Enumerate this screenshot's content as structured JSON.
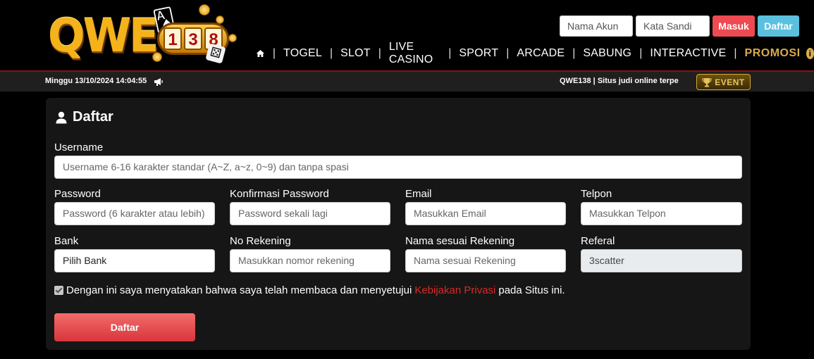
{
  "brand": {
    "logo_text": "QWE",
    "logo_digits": [
      "1",
      "3",
      "8"
    ]
  },
  "login": {
    "username_placeholder": "Nama Akun",
    "password_placeholder": "Kata Sandi",
    "login_label": "Masuk",
    "register_label": "Daftar"
  },
  "nav": {
    "home_icon": "home-icon",
    "items": [
      "TOGEL",
      "SLOT",
      "LIVE CASINO",
      "SPORT",
      "ARCADE",
      "SABUNG",
      "INTERACTIVE"
    ],
    "promo": "PROMOSI"
  },
  "ticker": {
    "datetime": "Minggu 13/10/2024 14:04:55",
    "marquee": "QWE138 | Situs judi online terpe",
    "event_label": "EVENT"
  },
  "form": {
    "title": "Daftar",
    "username": {
      "label": "Username",
      "placeholder": "Username 6-16 karakter standar (A~Z, a~z, 0~9) dan tanpa spasi"
    },
    "password": {
      "label": "Password",
      "placeholder": "Password (6 karakter atau lebih)"
    },
    "confirm": {
      "label": "Konfirmasi Password",
      "placeholder": "Password sekali lagi"
    },
    "email": {
      "label": "Email",
      "placeholder": "Masukkan Email"
    },
    "phone": {
      "label": "Telpon",
      "placeholder": "Masukkan Telpon"
    },
    "bank": {
      "label": "Bank",
      "value": "Pilih Bank"
    },
    "account_no": {
      "label": "No Rekening",
      "placeholder": "Masukkan nomor rekening"
    },
    "account_name": {
      "label": "Nama sesuai Rekening",
      "placeholder": "Nama sesuai Rekening"
    },
    "referral": {
      "label": "Referal",
      "value": "3scatter"
    },
    "agree_prefix": "Dengan ini saya menyatakan bahwa saya telah membaca dan menyetujui",
    "agree_link": "Kebijakan Privasi",
    "agree_suffix": "pada Situs ini.",
    "agree_checked": true,
    "submit_label": "Daftar"
  },
  "colors": {
    "accent_red": "#ee4a52",
    "accent_blue": "#5bc0de",
    "gold": "#d9ac4a",
    "panel": "#161616"
  }
}
